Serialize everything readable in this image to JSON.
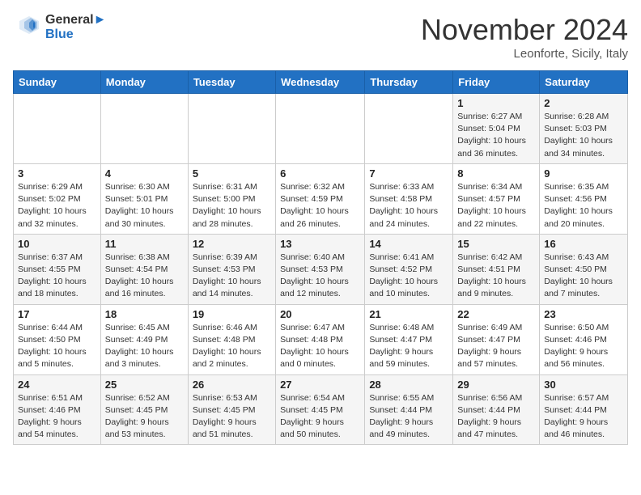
{
  "header": {
    "logo_line1": "General",
    "logo_line2": "Blue",
    "month": "November 2024",
    "location": "Leonforte, Sicily, Italy"
  },
  "weekdays": [
    "Sunday",
    "Monday",
    "Tuesday",
    "Wednesday",
    "Thursday",
    "Friday",
    "Saturday"
  ],
  "weeks": [
    [
      {
        "day": "",
        "info": ""
      },
      {
        "day": "",
        "info": ""
      },
      {
        "day": "",
        "info": ""
      },
      {
        "day": "",
        "info": ""
      },
      {
        "day": "",
        "info": ""
      },
      {
        "day": "1",
        "info": "Sunrise: 6:27 AM\nSunset: 5:04 PM\nDaylight: 10 hours\nand 36 minutes."
      },
      {
        "day": "2",
        "info": "Sunrise: 6:28 AM\nSunset: 5:03 PM\nDaylight: 10 hours\nand 34 minutes."
      }
    ],
    [
      {
        "day": "3",
        "info": "Sunrise: 6:29 AM\nSunset: 5:02 PM\nDaylight: 10 hours\nand 32 minutes."
      },
      {
        "day": "4",
        "info": "Sunrise: 6:30 AM\nSunset: 5:01 PM\nDaylight: 10 hours\nand 30 minutes."
      },
      {
        "day": "5",
        "info": "Sunrise: 6:31 AM\nSunset: 5:00 PM\nDaylight: 10 hours\nand 28 minutes."
      },
      {
        "day": "6",
        "info": "Sunrise: 6:32 AM\nSunset: 4:59 PM\nDaylight: 10 hours\nand 26 minutes."
      },
      {
        "day": "7",
        "info": "Sunrise: 6:33 AM\nSunset: 4:58 PM\nDaylight: 10 hours\nand 24 minutes."
      },
      {
        "day": "8",
        "info": "Sunrise: 6:34 AM\nSunset: 4:57 PM\nDaylight: 10 hours\nand 22 minutes."
      },
      {
        "day": "9",
        "info": "Sunrise: 6:35 AM\nSunset: 4:56 PM\nDaylight: 10 hours\nand 20 minutes."
      }
    ],
    [
      {
        "day": "10",
        "info": "Sunrise: 6:37 AM\nSunset: 4:55 PM\nDaylight: 10 hours\nand 18 minutes."
      },
      {
        "day": "11",
        "info": "Sunrise: 6:38 AM\nSunset: 4:54 PM\nDaylight: 10 hours\nand 16 minutes."
      },
      {
        "day": "12",
        "info": "Sunrise: 6:39 AM\nSunset: 4:53 PM\nDaylight: 10 hours\nand 14 minutes."
      },
      {
        "day": "13",
        "info": "Sunrise: 6:40 AM\nSunset: 4:53 PM\nDaylight: 10 hours\nand 12 minutes."
      },
      {
        "day": "14",
        "info": "Sunrise: 6:41 AM\nSunset: 4:52 PM\nDaylight: 10 hours\nand 10 minutes."
      },
      {
        "day": "15",
        "info": "Sunrise: 6:42 AM\nSunset: 4:51 PM\nDaylight: 10 hours\nand 9 minutes."
      },
      {
        "day": "16",
        "info": "Sunrise: 6:43 AM\nSunset: 4:50 PM\nDaylight: 10 hours\nand 7 minutes."
      }
    ],
    [
      {
        "day": "17",
        "info": "Sunrise: 6:44 AM\nSunset: 4:50 PM\nDaylight: 10 hours\nand 5 minutes."
      },
      {
        "day": "18",
        "info": "Sunrise: 6:45 AM\nSunset: 4:49 PM\nDaylight: 10 hours\nand 3 minutes."
      },
      {
        "day": "19",
        "info": "Sunrise: 6:46 AM\nSunset: 4:48 PM\nDaylight: 10 hours\nand 2 minutes."
      },
      {
        "day": "20",
        "info": "Sunrise: 6:47 AM\nSunset: 4:48 PM\nDaylight: 10 hours\nand 0 minutes."
      },
      {
        "day": "21",
        "info": "Sunrise: 6:48 AM\nSunset: 4:47 PM\nDaylight: 9 hours\nand 59 minutes."
      },
      {
        "day": "22",
        "info": "Sunrise: 6:49 AM\nSunset: 4:47 PM\nDaylight: 9 hours\nand 57 minutes."
      },
      {
        "day": "23",
        "info": "Sunrise: 6:50 AM\nSunset: 4:46 PM\nDaylight: 9 hours\nand 56 minutes."
      }
    ],
    [
      {
        "day": "24",
        "info": "Sunrise: 6:51 AM\nSunset: 4:46 PM\nDaylight: 9 hours\nand 54 minutes."
      },
      {
        "day": "25",
        "info": "Sunrise: 6:52 AM\nSunset: 4:45 PM\nDaylight: 9 hours\nand 53 minutes."
      },
      {
        "day": "26",
        "info": "Sunrise: 6:53 AM\nSunset: 4:45 PM\nDaylight: 9 hours\nand 51 minutes."
      },
      {
        "day": "27",
        "info": "Sunrise: 6:54 AM\nSunset: 4:45 PM\nDaylight: 9 hours\nand 50 minutes."
      },
      {
        "day": "28",
        "info": "Sunrise: 6:55 AM\nSunset: 4:44 PM\nDaylight: 9 hours\nand 49 minutes."
      },
      {
        "day": "29",
        "info": "Sunrise: 6:56 AM\nSunset: 4:44 PM\nDaylight: 9 hours\nand 47 minutes."
      },
      {
        "day": "30",
        "info": "Sunrise: 6:57 AM\nSunset: 4:44 PM\nDaylight: 9 hours\nand 46 minutes."
      }
    ]
  ]
}
